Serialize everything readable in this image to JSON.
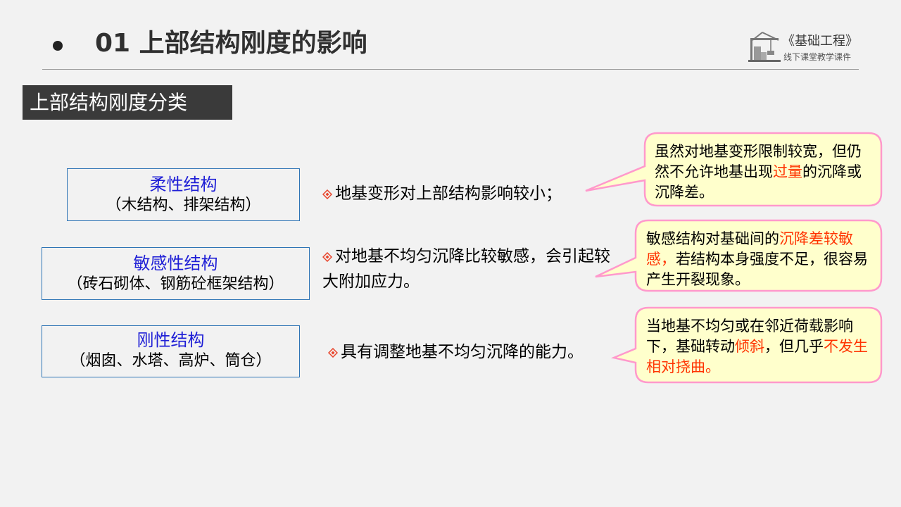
{
  "header": {
    "title": "01  上部结构刚度的影响",
    "logo_title": "《基础工程》",
    "logo_subtitle": "线下课堂教学课件"
  },
  "section_label": "上部结构刚度分类",
  "types": [
    {
      "name": "柔性结构",
      "example": "（木结构、排架结构）",
      "description": "地基变形对上部结构影响较小；",
      "callout": {
        "parts": [
          "虽然对地基变形限制较宽，但仍然不允许地基出现",
          "过量",
          "的沉降或沉降差。"
        ]
      }
    },
    {
      "name": "敏感性结构",
      "example": "（砖石砌体、钢筋砼框架结构）",
      "description": "对地基不均匀沉降比较敏感，会引起较大附加应力。",
      "callout": {
        "parts": [
          "敏感结构对基础间的",
          "沉降差较敏感，",
          "若结构本身强度不足，很容易产生开裂现象。"
        ]
      }
    },
    {
      "name": "刚性结构",
      "example": "（烟囱、水塔、高炉、筒仓）",
      "description": "具有调整地基不均匀沉降的能力。",
      "callout": {
        "parts": [
          "当地基不均匀或在邻近荷载影响下，基础转动",
          "倾斜",
          "，但几乎",
          "不发生相对挠曲。"
        ]
      }
    }
  ],
  "colors": {
    "accent_red": "#ff3300",
    "type_name_blue": "#1f1fd6",
    "callout_fill": "#ffffcc",
    "callout_border": "#ff99cc",
    "box_border": "#2e74b5",
    "bullet_diamond": "#e8432a"
  }
}
